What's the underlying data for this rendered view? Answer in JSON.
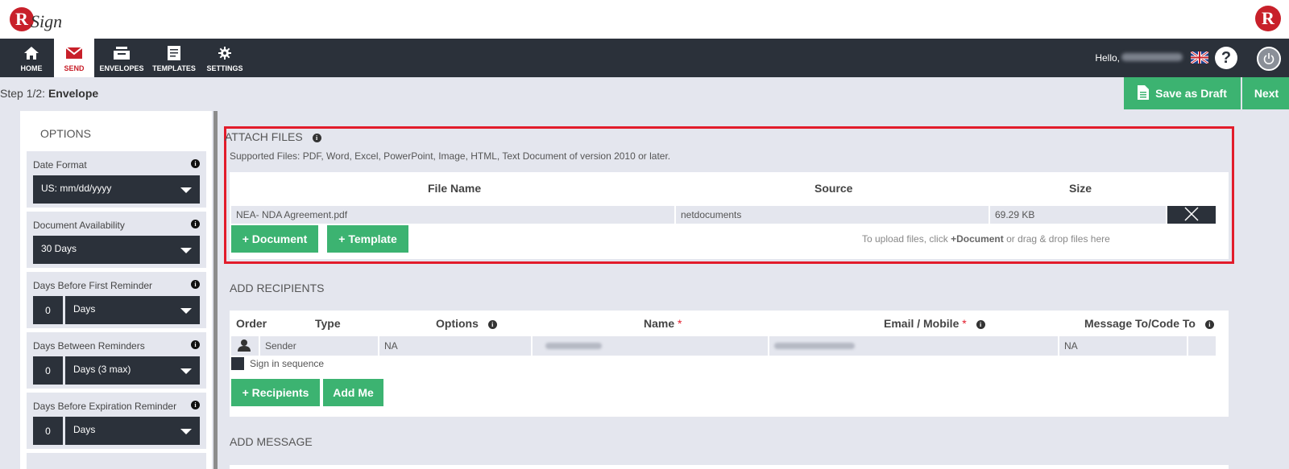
{
  "brand": {
    "logo_letter": "R",
    "logo_script": "Sign",
    "right_logo_letter": "R",
    "accent": "#c8202a"
  },
  "nav": {
    "items": [
      {
        "label": "HOME",
        "icon": "home-icon"
      },
      {
        "label": "SEND",
        "icon": "envelope-icon",
        "active": true
      },
      {
        "label": "ENVELOPES",
        "icon": "inbox-icon"
      },
      {
        "label": "TEMPLATES",
        "icon": "template-icon"
      },
      {
        "label": "SETTINGS",
        "icon": "gear-icon"
      }
    ],
    "hello": "Hello,"
  },
  "step": {
    "prefix": "Step 1/2:",
    "name": "Envelope",
    "save_draft": "Save as Draft",
    "next": "Next"
  },
  "options": {
    "title": "OPTIONS",
    "date_format": {
      "label": "Date Format",
      "value": "US: mm/dd/yyyy"
    },
    "doc_availability": {
      "label": "Document Availability",
      "value": "30 Days"
    },
    "first_reminder": {
      "label": "Days Before First Reminder",
      "num": "0",
      "unit": "Days"
    },
    "between_reminders": {
      "label": "Days Between Reminders",
      "num": "0",
      "unit": "Days (3 max)"
    },
    "expiration_reminder": {
      "label": "Days Before Expiration Reminder",
      "num": "0",
      "unit": "Days"
    }
  },
  "attach": {
    "title": "ATTACH FILES",
    "supported": "Supported Files: PDF, Word, Excel, PowerPoint, Image, HTML, Text Document of version 2010 or later.",
    "headers": {
      "file_name": "File Name",
      "source": "Source",
      "size": "Size"
    },
    "files": [
      {
        "name": "NEA- NDA Agreement.pdf",
        "source": "netdocuments",
        "size": "69.29 KB"
      }
    ],
    "add_document": "+ Document",
    "add_template": "+ Template",
    "hint_pre": "To upload files, click ",
    "hint_bold": "+Document",
    "hint_post": " or drag & drop files here"
  },
  "recipients": {
    "title": "ADD RECIPIENTS",
    "headers": {
      "order": "Order",
      "type": "Type",
      "options": "Options",
      "name": "Name",
      "email": "Email / Mobile",
      "message": "Message To/Code To"
    },
    "required_mark": "*",
    "rows": [
      {
        "type": "Sender",
        "options": "NA",
        "message": "NA"
      }
    ],
    "sign_in_sequence": "Sign in sequence",
    "add_recipients": "+ Recipients",
    "add_me": "Add Me"
  },
  "message": {
    "title": "ADD MESSAGE"
  }
}
